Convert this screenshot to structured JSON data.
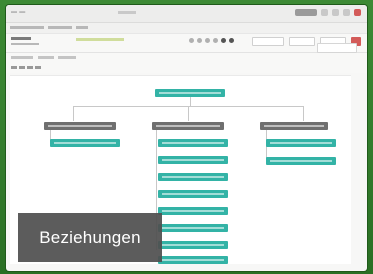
{
  "caption": {
    "text": "Beziehungen"
  },
  "colors": {
    "background": "#2f7d2a",
    "node_teal": "#33b3a6",
    "node_header": "#6f6f6f",
    "caption_bg": "#505050"
  },
  "icons": [
    "user-avatar-icon",
    "notification-icon",
    "settings-icon",
    "help-icon",
    "close-icon"
  ],
  "diagram": {
    "root": {
      "label": ""
    },
    "groups": [
      {
        "header": "",
        "children": 1
      },
      {
        "header": "",
        "children": 8
      },
      {
        "header": "",
        "children": 2
      }
    ]
  }
}
